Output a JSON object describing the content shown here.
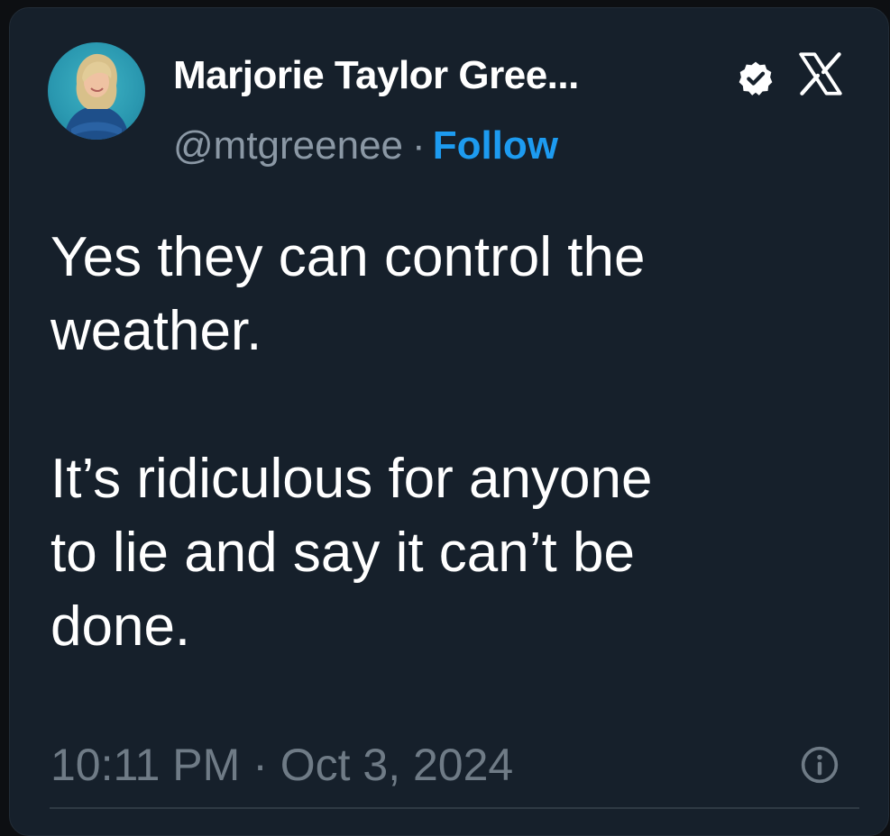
{
  "tweet": {
    "author": {
      "name": "Marjorie Taylor Gree...",
      "handle": "@mtgreenee",
      "separator": "·",
      "follow_label": "Follow",
      "verified_icon": "verified-badge-icon",
      "platform_icon": "x-logo-icon"
    },
    "text": "Yes they can control the\nweather.\n\nIt’s ridiculous for anyone\nto lie and say it can’t be\ndone.",
    "timestamp": "10:11 PM · Oct 3, 2024",
    "info_icon": "info-icon"
  },
  "colors": {
    "background": "#16202b",
    "text": "#ffffff",
    "muted": "#8b98a5",
    "accent": "#1d9bf0"
  }
}
